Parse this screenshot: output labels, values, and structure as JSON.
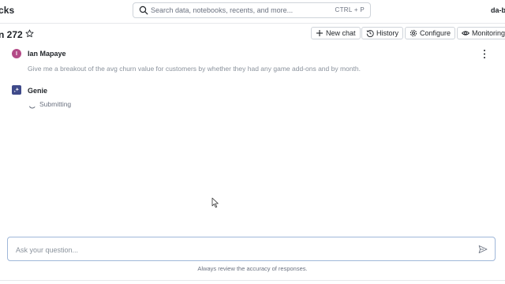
{
  "header": {
    "brand": "cks",
    "search": {
      "placeholder": "Search data, notebooks, recents, and more...",
      "shortcut": "CTRL + P"
    },
    "user_tag": "da-b"
  },
  "space": {
    "title": "n 272",
    "actions": {
      "new_chat": "New chat",
      "history": "History",
      "configure": "Configure",
      "monitoring": "Monitoring"
    }
  },
  "conversation": {
    "user": {
      "initial": "I",
      "name": "Ian Mapaye",
      "message": "Give me a breakout of the avg churn value for customers by whether they had any game add-ons and by month."
    },
    "assistant": {
      "name": "Genie",
      "status": "Submitting"
    }
  },
  "composer": {
    "placeholder": "Ask your question...",
    "disclaimer": "Always review the accuracy of responses."
  },
  "colors": {
    "user_avatar": "#b34a87",
    "genie_avatar": "#3f4a8a",
    "input_border": "#9fb7d9"
  }
}
